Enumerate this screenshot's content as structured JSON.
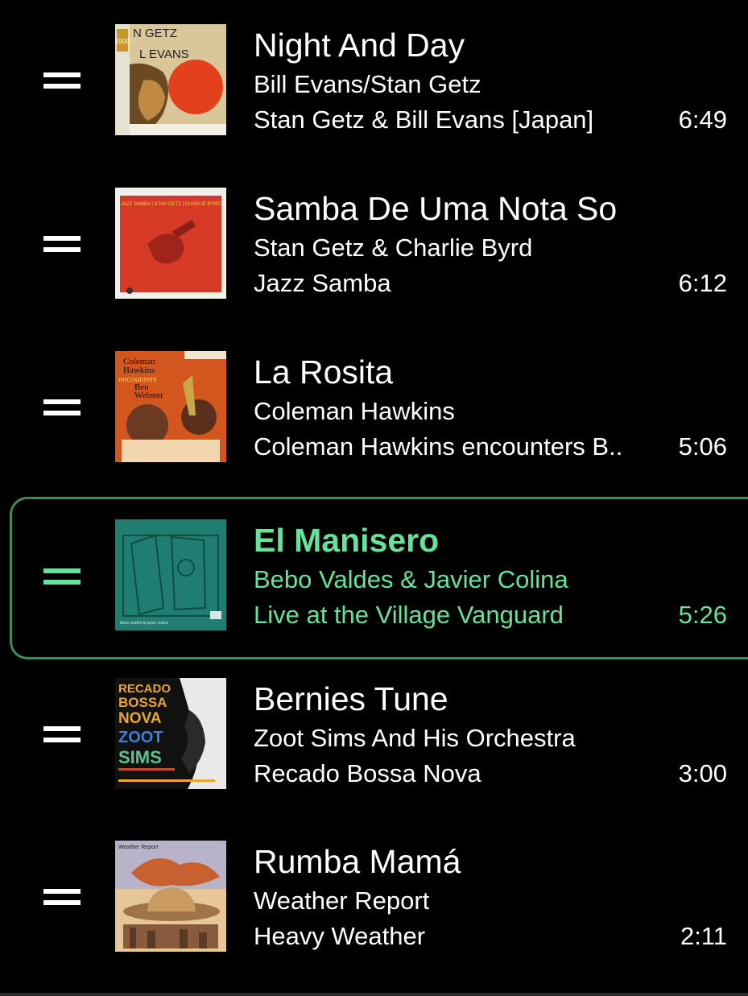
{
  "queue": {
    "tracks": [
      {
        "title": "Night And Day",
        "artist": "Bill Evans/Stan Getz",
        "album": "Stan Getz & Bill Evans [Japan]",
        "duration": "6:49",
        "cover_text": "N GETZ",
        "cover_text2": "L EVANS",
        "cover_badge": "1500",
        "active": false
      },
      {
        "title": "Samba De Uma Nota So",
        "artist": "Stan Getz & Charlie Byrd",
        "album": "Jazz Samba",
        "duration": "6:12",
        "cover_text": "JAZZ SAMBA | STAN GETZ | CHARLIE BYRD",
        "active": false
      },
      {
        "title": "La Rosita",
        "artist": "Coleman Hawkins",
        "album": "Coleman Hawkins encounters B..",
        "duration": "5:06",
        "cover_text": "Coleman",
        "cover_text2": "Hawkins",
        "cover_text3": "encounters",
        "cover_text4": "Ben",
        "cover_text5": "Webster",
        "active": false
      },
      {
        "title": "El Manisero",
        "artist": "Bebo Valdes & Javier Colina",
        "album": "Live at the Village Vanguard",
        "duration": "5:26",
        "cover_text": "bebo valdés & javier colina",
        "active": true
      },
      {
        "title": "Bernies Tune",
        "artist": "Zoot Sims And His Orchestra",
        "album": "Recado Bossa Nova",
        "duration": "3:00",
        "cover_text": "RECADO",
        "cover_text2": "BOSSA",
        "cover_text3": "NOVA",
        "cover_text4": "ZOOT",
        "cover_text5": "SIMS",
        "active": false
      },
      {
        "title": "Rumba Mamá",
        "artist": "Weather Report",
        "album": "Heavy Weather",
        "duration": "2:11",
        "cover_text": "Weather Report",
        "active": false
      }
    ]
  },
  "colors": {
    "background": "#000000",
    "text": "#ffffff",
    "active_accent": "#66e29a",
    "active_border": "#3f8a5a"
  }
}
